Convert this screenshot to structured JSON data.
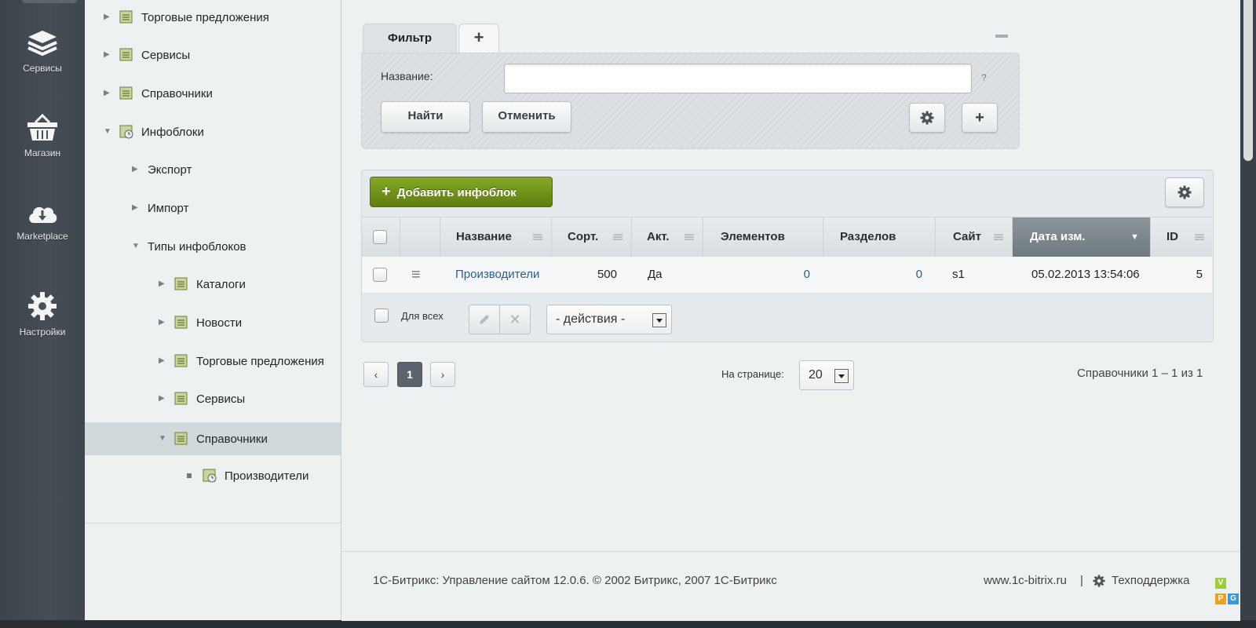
{
  "rail": {
    "items": [
      {
        "label": "Сервисы",
        "icon": "layers-icon"
      },
      {
        "label": "Магазин",
        "icon": "basket-icon"
      },
      {
        "label": "Marketplace",
        "icon": "cloud-download-icon"
      },
      {
        "label": "Настройки",
        "icon": "gear-icon"
      }
    ]
  },
  "tree": {
    "items": [
      {
        "label": "Торговые предложения"
      },
      {
        "label": "Сервисы"
      },
      {
        "label": "Справочники"
      },
      {
        "label": "Инфоблоки"
      },
      {
        "label": "Экспорт"
      },
      {
        "label": "Импорт"
      },
      {
        "label": "Типы инфоблоков"
      },
      {
        "label": "Каталоги"
      },
      {
        "label": "Новости"
      },
      {
        "label": "Торговые предложения"
      },
      {
        "label": "Сервисы"
      },
      {
        "label": "Справочники"
      },
      {
        "label": "Производители"
      }
    ]
  },
  "filter": {
    "tab_label": "Фильтр",
    "add_tab": "+",
    "name_label": "Название:",
    "name_value": "",
    "help": "?",
    "find_button": "Найти",
    "cancel_button": "Отменить",
    "plus_button": "+"
  },
  "list": {
    "add_button": "Добавить инфоблок",
    "columns": [
      "Название",
      "Сорт.",
      "Акт.",
      "Элементов",
      "Разделов",
      "Сайт",
      "Дата изм.",
      "ID"
    ],
    "rows": [
      {
        "name": "Производители",
        "sort": "500",
        "active": "Да",
        "elements": "0",
        "sections": "0",
        "site": "s1",
        "date": "05.02.2013 13:54:06",
        "id": "5"
      }
    ],
    "for_all": "Для всех",
    "actions_select": "- действия -"
  },
  "pager": {
    "prev": "‹",
    "current": "1",
    "next": "›",
    "per_page_label": "На странице:",
    "per_page_value": "20",
    "summary": "Справочники 1 – 1 из 1"
  },
  "footer": {
    "copyright": "1С-Битрикс: Управление сайтом 12.0.6. © 2002 Битрикс, 2007 1С-Битрикс",
    "site_link": "www.1c-bitrix.ru",
    "separator": "|",
    "support": "Техподдержка"
  },
  "watermark": {
    "letters": [
      "V",
      "P",
      "G"
    ]
  }
}
